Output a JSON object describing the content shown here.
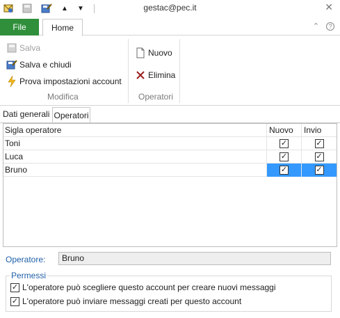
{
  "window": {
    "title": "gestac@pec.it",
    "close_glyph": "✕"
  },
  "quick_access": {
    "up_glyph": "▲",
    "down_glyph": "▼"
  },
  "ribbon": {
    "file_tab": "File",
    "home_tab": "Home",
    "groups": {
      "modifica": {
        "label": "Modifica",
        "salva": "Salva",
        "salva_chiudi": "Salva e chiudi",
        "prova": "Prova impostazioni account"
      },
      "operatori": {
        "label": "Operatori",
        "nuovo": "Nuovo",
        "elimina": "Elimina"
      }
    }
  },
  "tabs": {
    "dati_generali": "Dati generali",
    "operatori": "Operatori"
  },
  "grid": {
    "headers": [
      "Sigla operatore",
      "Nuovo",
      "Invio"
    ],
    "rows": [
      {
        "name": "Toni",
        "nuovo": true,
        "invio": true,
        "selected": false
      },
      {
        "name": "Luca",
        "nuovo": true,
        "invio": true,
        "selected": false
      },
      {
        "name": "Bruno",
        "nuovo": true,
        "invio": true,
        "selected": true
      }
    ]
  },
  "operator": {
    "label": "Operatore:",
    "value": "Bruno"
  },
  "permissions": {
    "legend": "Permessi",
    "items": [
      {
        "label": "L'operatore può scegliere questo account per creare nuovi messaggi",
        "checked": true
      },
      {
        "label": "L'operatore può inviare messaggi creati per questo account",
        "checked": true
      }
    ]
  },
  "colors": {
    "file_tab": "#2f8f3b",
    "selection": "#3399ff",
    "label_blue": "#1f5fa8"
  }
}
